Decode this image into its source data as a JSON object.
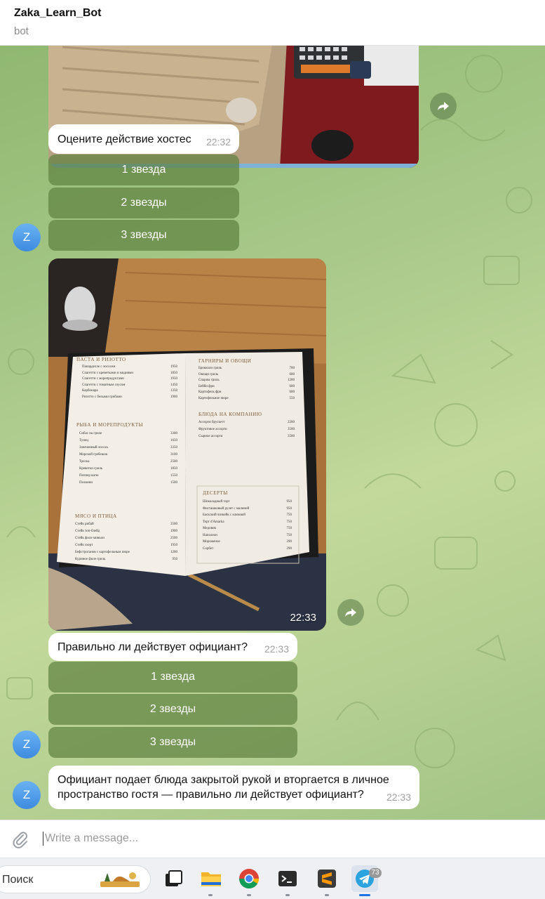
{
  "header": {
    "title": "Zaka_Learn_Bot",
    "subtitle": "bot"
  },
  "avatar_letter": "Z",
  "messages": {
    "q1": {
      "text": "Оцените действие хостес",
      "time": "22:32"
    },
    "photo2_time": "22:33",
    "q2": {
      "text": "Правильно ли действует официант?",
      "time": "22:33"
    },
    "q3": {
      "text": "Официант подает блюда закрытой рукой и вторгается в личное пространство гостя — правильно ли действует официант?",
      "time": "22:33"
    }
  },
  "keyboard1": [
    "1 звезда",
    "2 звезды",
    "3 звезды"
  ],
  "keyboard2": [
    "1 звезда",
    "2 звезды",
    "3 звезды"
  ],
  "menu_photo": {
    "left_sections": [
      {
        "title": "ПАСТА И РИЗОТТО",
        "items": [
          [
            "Папарделле с лососем",
            "1950"
          ],
          [
            "Спагетти с креветками и мидиями",
            "1850"
          ],
          [
            "Спагетти с морепродуктами",
            "1950"
          ],
          [
            "Спагетти с томатным соусом",
            "1450"
          ],
          [
            "Карбонара",
            "1350"
          ],
          [
            "Ризотто с белыми грибами",
            "1900"
          ]
        ]
      },
      {
        "title": "РЫБА И МОРЕПРОДУКТЫ",
        "items": [
          [
            "Сибас на гриле",
            "3300"
          ],
          [
            "Тунец",
            "1650"
          ],
          [
            "Запеченный лосось",
            "3350"
          ],
          [
            "Морской гребешок",
            "3100"
          ],
          [
            "Треска",
            "2500"
          ],
          [
            "Креветки гриль",
            "1850"
          ],
          [
            "Пеппер вагю",
            "1550"
          ],
          [
            "Пелмени",
            "1500"
          ]
        ]
      },
      {
        "title": "МЯСО И ПТИЦА",
        "items": [
          [
            "Стейк рибай",
            "3500"
          ],
          [
            "Стейк топ-блейд",
            "1900"
          ],
          [
            "Стейк филе миньон",
            "2500"
          ],
          [
            "Стейк скерт",
            "1950"
          ],
          [
            "Бефстроганов с картофельным пюре",
            "1200"
          ],
          [
            "Куриное филе гриль",
            "950"
          ]
        ]
      }
    ],
    "right_sections": [
      {
        "title": "ГАРНИРЫ И ОВОЩИ",
        "items": [
          [
            "Брокколи гриль",
            "700"
          ],
          [
            "Овощи гриль",
            "600"
          ],
          [
            "Спаржа гриль",
            "1200"
          ],
          [
            "Бейби фри",
            "600"
          ],
          [
            "Картофель фри",
            "600"
          ],
          [
            "Картофельное пюре",
            "550"
          ]
        ]
      },
      {
        "title": "БЛЮДА НА КОМПАНИЮ",
        "items": [
          [
            "Ассорти брускетт",
            "2200"
          ],
          [
            "Фруктовое ассорти",
            "3500"
          ],
          [
            "Сырное ассорти",
            "3500"
          ]
        ]
      },
      {
        "title": "ДЕСЕРТЫ",
        "items": [
          [
            "Шоколадный торт",
            "950"
          ],
          [
            "Фисташковый рулет с малиной",
            "950"
          ],
          [
            "Баскский чизкейк с клюквой",
            "750"
          ],
          [
            "Торт d'Amarka",
            "750"
          ],
          [
            "Медовик",
            "750"
          ],
          [
            "Наполеон",
            "750"
          ],
          [
            "Мороженое",
            "290"
          ],
          [
            "Сорбет",
            "290"
          ]
        ]
      }
    ]
  },
  "composer": {
    "placeholder": "Write a message..."
  },
  "taskbar": {
    "search_label": "Поиск",
    "telegram_badge": "73"
  },
  "colors": {
    "accent": "#3d8be0",
    "keyboard_button": "#6a8f4a",
    "wallpaper": "#a9c98a"
  }
}
